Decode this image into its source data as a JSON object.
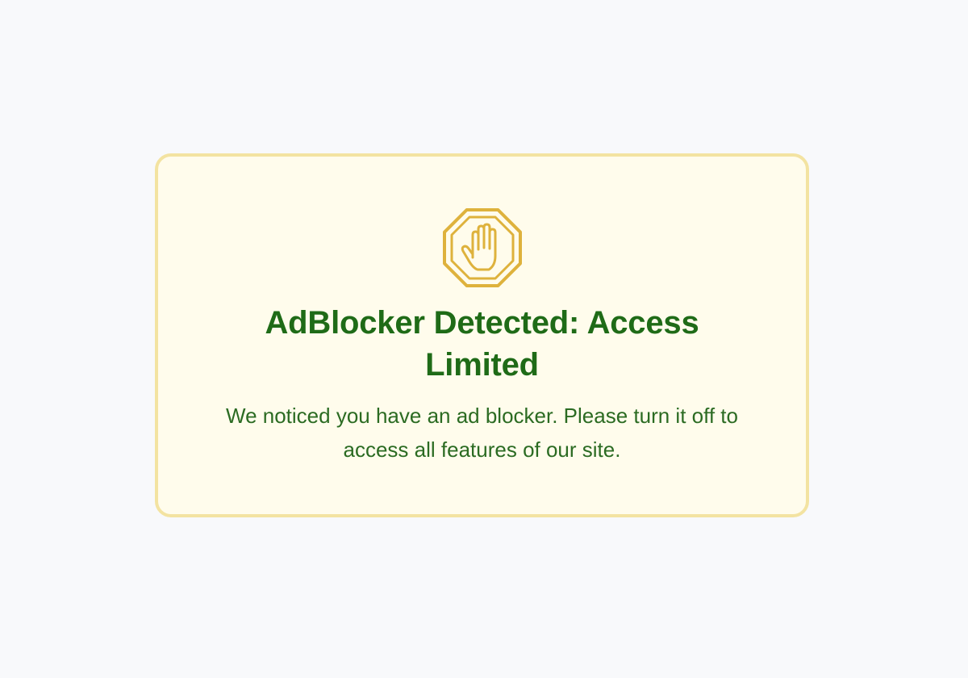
{
  "notice": {
    "icon": "stop-hand-icon",
    "title": "AdBlocker Detected: Access Limited",
    "message": "We noticed you have an ad blocker. Please turn it off to access all features of our site."
  },
  "colors": {
    "page_background": "#f8f9fb",
    "card_background": "#fffcec",
    "card_border": "#f3e3a1",
    "icon": "#deb23c",
    "title": "#1f6b17",
    "message": "#2b6b22"
  }
}
